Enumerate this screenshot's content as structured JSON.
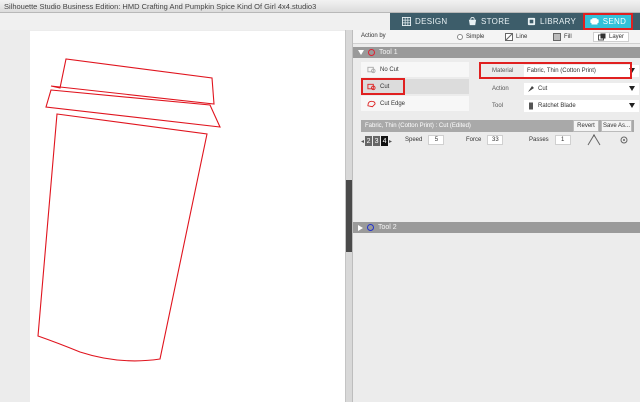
{
  "window": {
    "title": "Silhouette Studio Business Edition: HMD Crafting And Pumpkin Spice Kind Of Girl 4x4.studio3"
  },
  "nav": {
    "tabs": [
      {
        "label": "DESIGN",
        "icon": "grid-icon"
      },
      {
        "label": "STORE",
        "icon": "store-icon"
      },
      {
        "label": "LIBRARY",
        "icon": "library-icon"
      },
      {
        "label": "SEND",
        "icon": "send-icon",
        "active": true
      }
    ],
    "accent": "#33c1d9",
    "bar_color": "#3d5d6a",
    "highlight_color": "#e02020"
  },
  "action_by": {
    "label": "Action by",
    "options": [
      {
        "label": "Simple",
        "icon": "radio-icon"
      },
      {
        "label": "Line",
        "icon": "line-icon"
      },
      {
        "label": "Fill",
        "icon": "fill-icon"
      },
      {
        "label": "Layer",
        "icon": "layer-icon",
        "selected": true
      }
    ]
  },
  "tools": {
    "tool1": {
      "label": "Tool 1",
      "color": "#dd2233"
    },
    "tool2": {
      "label": "Tool 2",
      "color": "#2233cc"
    }
  },
  "cut_options": {
    "no_cut": "No Cut",
    "cut": "Cut",
    "cut_edge": "Cut Edge",
    "selected": "Cut"
  },
  "properties": {
    "material": {
      "label": "Material",
      "value": "Fabric, Thin (Cotton Print)"
    },
    "action": {
      "label": "Action",
      "value": "Cut"
    },
    "tool": {
      "label": "Tool",
      "value": "Ratchet Blade"
    }
  },
  "material_bar": {
    "text": "Fabric, Thin (Cotton Print) : Cut (Edited)",
    "revert_label": "Revert",
    "save_as_label": "Save As..."
  },
  "settings": {
    "blade_levels": [
      "2",
      "3",
      "4"
    ],
    "blade_selected": "4",
    "speed": {
      "label": "Speed",
      "value": "5"
    },
    "force": {
      "label": "Force",
      "value": "33"
    },
    "passes": {
      "label": "Passes",
      "value": "1"
    }
  },
  "canvas": {
    "shape_color": "#e0141e"
  }
}
